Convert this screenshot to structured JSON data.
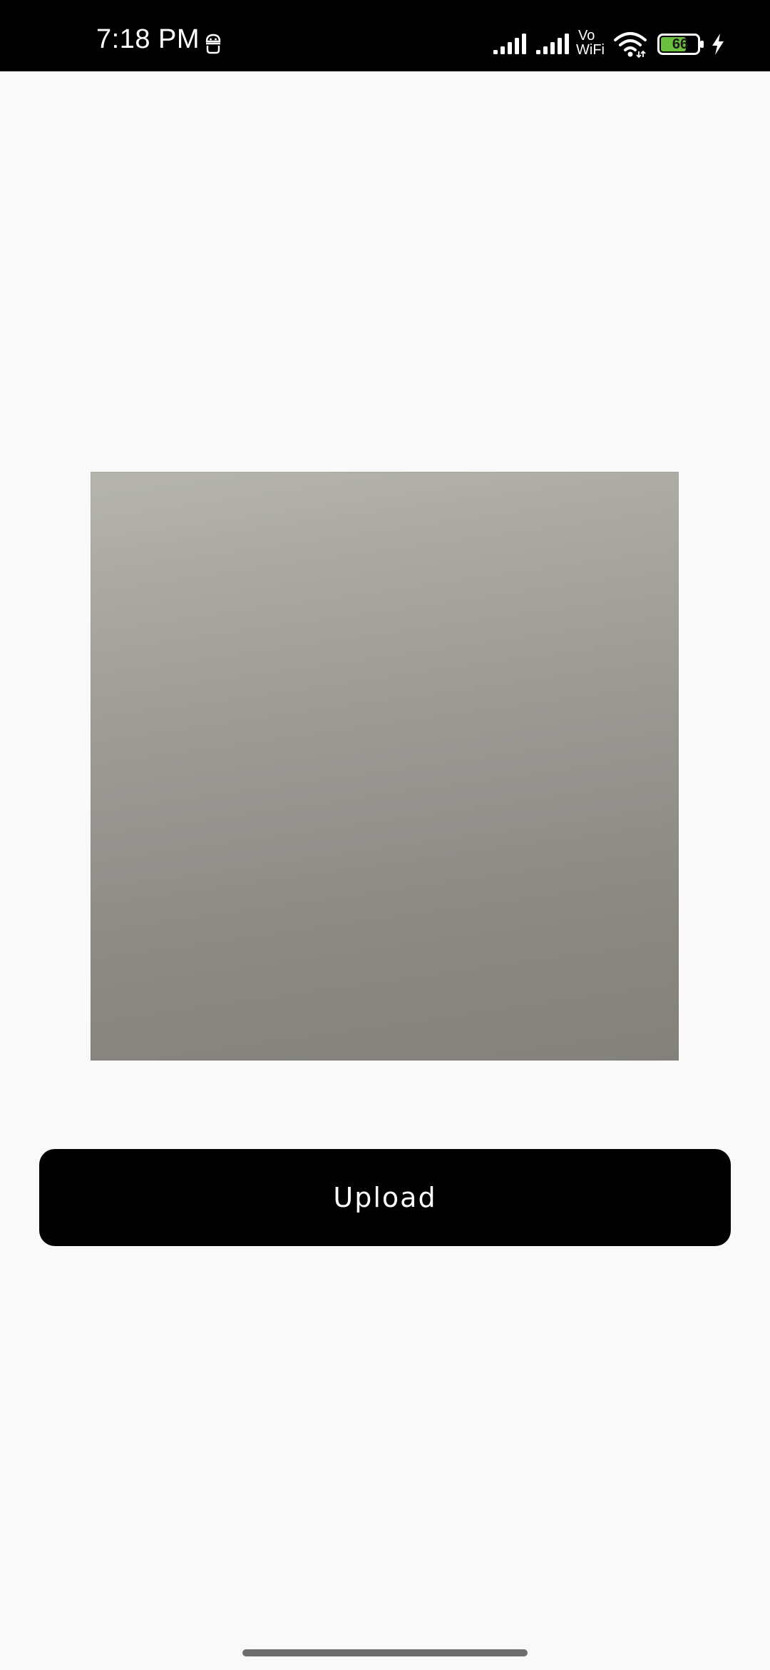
{
  "status_bar": {
    "time": "7:18 PM",
    "vo_label": "Vo",
    "wifi_label": "WiFi",
    "battery_level": "66",
    "colors": {
      "background": "#000000",
      "foreground": "#ffffff",
      "battery_fill": "#6abf3f"
    },
    "icons": [
      "android-icon",
      "signal-icon",
      "signal-icon",
      "vowifi-icon",
      "wifi-icon",
      "battery-icon",
      "charging-icon"
    ]
  },
  "main": {
    "upload_button": {
      "label": "Upload"
    },
    "colors": {
      "page_background": "#f9f9f9",
      "button_background": "#000000",
      "button_text": "#ffffff"
    }
  }
}
